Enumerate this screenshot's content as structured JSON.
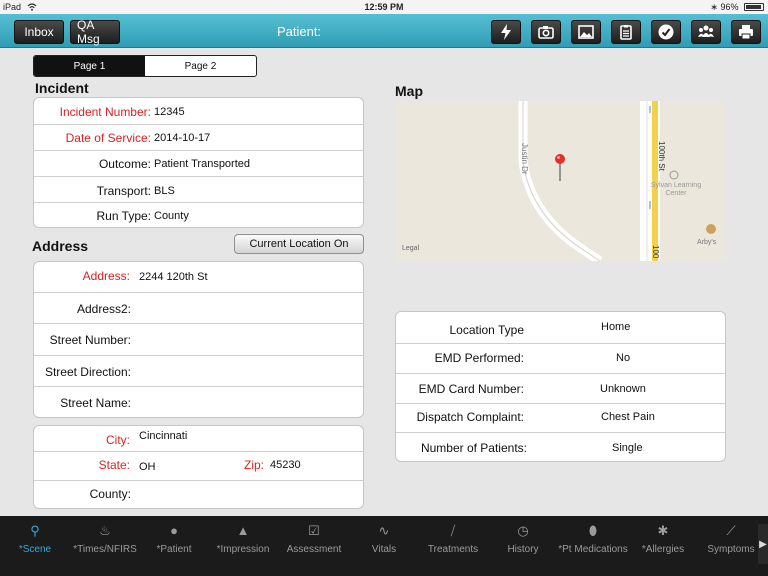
{
  "status_bar": {
    "device": "iPad",
    "time": "12:59 PM",
    "battery": "96%"
  },
  "toolbar": {
    "inbox_label": "Inbox",
    "qa_label": "QA Msg",
    "title": "Patient:"
  },
  "pages": {
    "page1": "Page 1",
    "page2": "Page 2"
  },
  "incident": {
    "title": "Incident",
    "rows": [
      {
        "label": "Incident Number:",
        "value": "12345"
      },
      {
        "label": "Date of Service:",
        "value": "2014-10-17"
      },
      {
        "label": "Outcome:",
        "value": "Patient Transported"
      },
      {
        "label": "Transport:",
        "value": "BLS"
      },
      {
        "label": "Run Type:",
        "value": "County"
      }
    ]
  },
  "address": {
    "title": "Address",
    "current_location_button": "Current Location On",
    "rows": [
      {
        "label": "Address:",
        "value": "2244 120th St"
      },
      {
        "label": "Address2:",
        "value": ""
      },
      {
        "label": "Street Number:",
        "value": ""
      },
      {
        "label": "Street Direction:",
        "value": ""
      },
      {
        "label": "Street Name:",
        "value": ""
      }
    ],
    "city_label": "City:",
    "city_value": "Cincinnati",
    "state_label": "State:",
    "state_value": "OH",
    "zip_label": "Zip:",
    "zip_value": "45230",
    "county_label": "County:",
    "county_value": ""
  },
  "map": {
    "title": "Map",
    "labels": {
      "road1": "Justin Dr",
      "road2": "100th St",
      "road3": "100",
      "poi1_line1": "Sylvan Learning",
      "poi1_line2": "Center",
      "poi2": "Arby's",
      "legal": "Legal"
    }
  },
  "dispatch": {
    "rows": [
      {
        "label": "Location Type",
        "value": "Home"
      },
      {
        "label": "EMD Performed:",
        "value": "No"
      },
      {
        "label": "EMD Card Number:",
        "value": "Unknown"
      },
      {
        "label": "Dispatch Complaint:",
        "value": "Chest Pain"
      },
      {
        "label": "Number of Patients:",
        "value": "Single"
      }
    ]
  },
  "tabs": [
    {
      "label": "*Scene",
      "icon": "pin-icon",
      "active": true
    },
    {
      "label": "*Times/NFIRS",
      "icon": "bike-icon"
    },
    {
      "label": "*Patient",
      "icon": "patient-icon"
    },
    {
      "label": "*Impression",
      "icon": "siren-icon"
    },
    {
      "label": "Assessment",
      "icon": "checkbox-icon"
    },
    {
      "label": "Vitals",
      "icon": "pulse-icon"
    },
    {
      "label": "Treatments",
      "icon": "bandage-icon"
    },
    {
      "label": "History",
      "icon": "clock-icon"
    },
    {
      "label": "*Pt Medications",
      "icon": "pill-icon"
    },
    {
      "label": "*Allergies",
      "icon": "allergy-icon"
    },
    {
      "label": "Symptoms",
      "icon": "syringe-icon"
    }
  ],
  "colors": {
    "accent": "#37a8d8",
    "required": "#d42424",
    "toolbar": "#3aaac1"
  }
}
